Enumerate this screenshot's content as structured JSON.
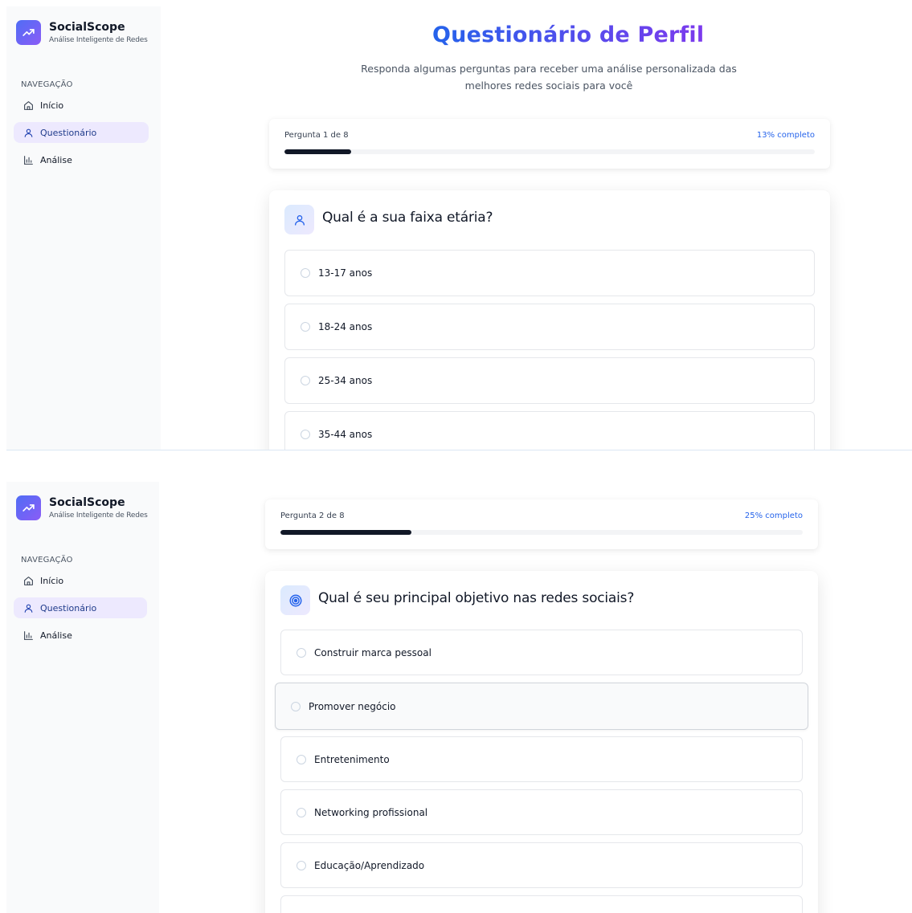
{
  "app": {
    "name": "SocialScope",
    "subtitle": "Análise Inteligente de Redes",
    "nav_title": "NAVEGAÇÃO",
    "nav": [
      {
        "label": "Início",
        "icon": "home-icon"
      },
      {
        "label": "Questionário",
        "icon": "user-icon",
        "active": true
      },
      {
        "label": "Análise",
        "icon": "bar-chart-icon"
      }
    ]
  },
  "screen1": {
    "title": "Questionário de Perfil",
    "subtitle": "Responda algumas perguntas para receber uma análise personalizada das melhores redes sociais para você",
    "progress": {
      "label": "Pergunta 1 de 8",
      "percent_label": "13% completo",
      "percent": 12.5
    },
    "question": {
      "icon": "user-icon",
      "text": "Qual é a sua faixa etária?",
      "options": [
        "13-17 anos",
        "18-24 anos",
        "25-34 anos",
        "35-44 anos"
      ]
    }
  },
  "screen2": {
    "progress": {
      "label": "Pergunta 2 de 8",
      "percent_label": "25% completo",
      "percent": 25
    },
    "question": {
      "icon": "target-icon",
      "text": "Qual é seu principal objetivo nas redes sociais?",
      "options": [
        "Construir marca pessoal",
        "Promover negócio",
        "Entretenimento",
        "Networking profissional",
        "Educação/Aprendizado",
        ""
      ],
      "hovered_option": "Promover negócio"
    }
  },
  "colors": {
    "brand_gradient_start": "#2563eb",
    "brand_gradient_end": "#7c3aed",
    "active_nav_bg": "#ede9fe",
    "progress_fill": "#111827",
    "percent_text": "#2563eb"
  }
}
